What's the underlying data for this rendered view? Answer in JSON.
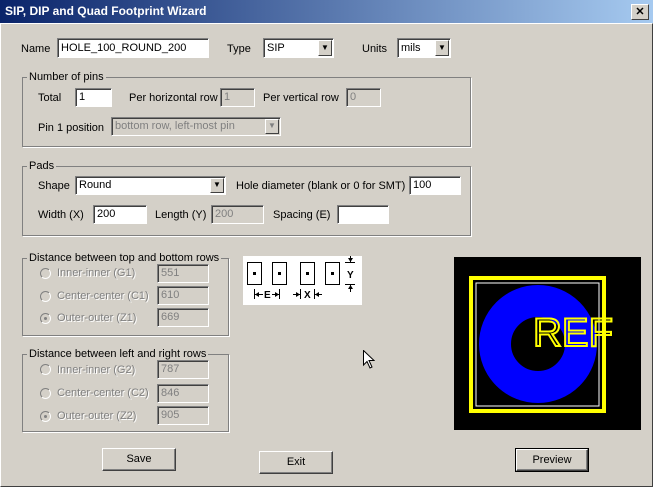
{
  "window": {
    "title": "SIP, DIP and Quad Footprint Wizard",
    "close_glyph": "✕"
  },
  "top": {
    "name_label": "Name",
    "name_value": "HOLE_100_ROUND_200",
    "type_label": "Type",
    "type_value": "SIP",
    "units_label": "Units",
    "units_value": "mils"
  },
  "pins": {
    "group_label": "Number of pins",
    "total_label": "Total",
    "total_value": "1",
    "per_h_label": "Per horizontal row",
    "per_h_value": "1",
    "per_v_label": "Per vertical row",
    "per_v_value": "0",
    "pin1_label": "Pin 1 position",
    "pin1_value": "bottom row, left-most pin"
  },
  "pads": {
    "group_label": "Pads",
    "shape_label": "Shape",
    "shape_value": "Round",
    "hole_label": "Hole diameter (blank or 0 for SMT)",
    "hole_value": "100",
    "width_label": "Width (X)",
    "width_value": "200",
    "length_label": "Length (Y)",
    "length_value": "200",
    "spacing_label": "Spacing (E)",
    "spacing_value": ""
  },
  "tb_rows": {
    "group_label": "Distance between top and bottom rows",
    "options": [
      {
        "label": "Inner-inner (G1)",
        "value": "551",
        "checked": false
      },
      {
        "label": "Center-center (C1)",
        "value": "610",
        "checked": false
      },
      {
        "label": "Outer-outer (Z1)",
        "value": "669",
        "checked": true
      }
    ]
  },
  "lr_rows": {
    "group_label": "Distance between left and right rows",
    "options": [
      {
        "label": "Inner-inner (G2)",
        "value": "787",
        "checked": false
      },
      {
        "label": "Center-center (C2)",
        "value": "846",
        "checked": false
      },
      {
        "label": "Outer-outer (Z2)",
        "value": "905",
        "checked": true
      }
    ]
  },
  "diagram": {
    "e_label": "E",
    "x_label": "X",
    "y_label": "Y"
  },
  "preview": {
    "ref_text": "REF",
    "pad_color": "#0000ff",
    "outline_color": "#ffff00",
    "bg_color": "#000000"
  },
  "buttons": {
    "save": "Save",
    "exit": "Exit",
    "preview": "Preview"
  }
}
